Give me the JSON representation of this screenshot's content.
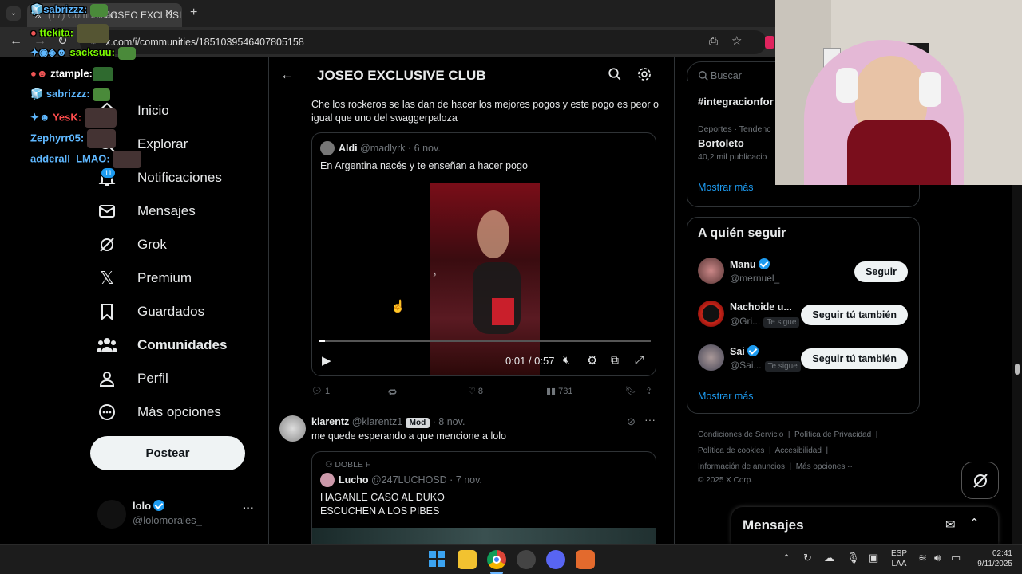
{
  "browser": {
    "tab_title": "(17) Comunidad",
    "tab_title_tail": "JOSEO EXCLUSI",
    "url": "x.com/i/communities/1851039546407805158"
  },
  "chat": [
    {
      "user": "sabrizzz:",
      "color": "#5fb8ff"
    },
    {
      "user": "ttekita:",
      "color": "#7cfc00"
    },
    {
      "user": "sacksuu:",
      "color": "#7cfc00"
    },
    {
      "user": "ztample:",
      "color": "#ffffff"
    },
    {
      "user": "sabrizzz:",
      "color": "#5fb8ff"
    },
    {
      "user": "YesK:",
      "color": "#ff4d4d"
    },
    {
      "user": "Zephyrr05:",
      "color": "#5fb8ff"
    },
    {
      "user": "adderall_LMAO:",
      "color": "#5fb8ff"
    }
  ],
  "nav": {
    "items": [
      "Inicio",
      "Explorar",
      "Notificaciones",
      "Mensajes",
      "Grok",
      "Premium",
      "Guardados",
      "Comunidades",
      "Perfil",
      "Más opciones"
    ],
    "notif_count": "11",
    "post_label": "Postear",
    "profile_name": "lolo",
    "profile_handle": "@lolomorales_"
  },
  "community": {
    "title": "JOSEO EXCLUSIVE CLUB"
  },
  "post1": {
    "text": "Che los rockeros se las dan de hacer los mejores pogos y este pogo es peor o igual que uno del swaggerpaloza",
    "quote_name": "Aldi",
    "quote_handle": "@madlyrk",
    "quote_date": "· 6 nov.",
    "quote_text": "En Argentina nacés y te enseñan a hacer pogo",
    "video_time": "0:01 / 0:57",
    "video_progress": 0.02,
    "replies": "1",
    "likes": "8",
    "views": "731"
  },
  "post2": {
    "name": "klarentz",
    "handle": "@klarentz1",
    "badge": "Mod",
    "date": "· 8 nov.",
    "text": "me quede esperando a que mencione a lolo",
    "quote_context": "DOBLE F",
    "quote_name": "Lucho",
    "quote_handle": "@247LUCHOSD",
    "quote_date": "· 7 nov.",
    "quote_line1": "HAGANLE CASO AL DUKO",
    "quote_line2": "ESCUCHEN A LOS PIBES"
  },
  "right": {
    "search_placeholder": "Buscar",
    "trend1": "#integracionfor",
    "trend2_meta": "Deportes · Tendenc",
    "trend2": "Bortoleto",
    "trend2_count": "40,2 mil publicacio",
    "show_more": "Mostrar más",
    "who_title": "A quién seguir",
    "follow": [
      {
        "name": "Manu",
        "handle": "@mernuel_",
        "btn": "Seguir",
        "verified": true,
        "tesigue": ""
      },
      {
        "name": "Nachoide u...",
        "handle": "@Gri...",
        "btn": "Seguir tú también",
        "verified": false,
        "tesigue": "Te sigue"
      },
      {
        "name": "Sai",
        "handle": "@Sai...",
        "btn": "Seguir tú también",
        "verified": true,
        "tesigue": "Te sigue"
      }
    ],
    "show_more2": "Mostrar más",
    "footer": {
      "l1": "Condiciones de Servicio",
      "l2": "Política de Privacidad",
      "l3": "Política de cookies",
      "l4": "Accesibilidad",
      "l5": "Información de anuncios",
      "l6": "Más opciones ···",
      "copyright": "© 2025 X Corp."
    },
    "messages": "Mensajes"
  },
  "taskbar": {
    "lang1": "ESP",
    "lang2": "LAA",
    "time": "02:41",
    "date": "9/11/2025"
  }
}
